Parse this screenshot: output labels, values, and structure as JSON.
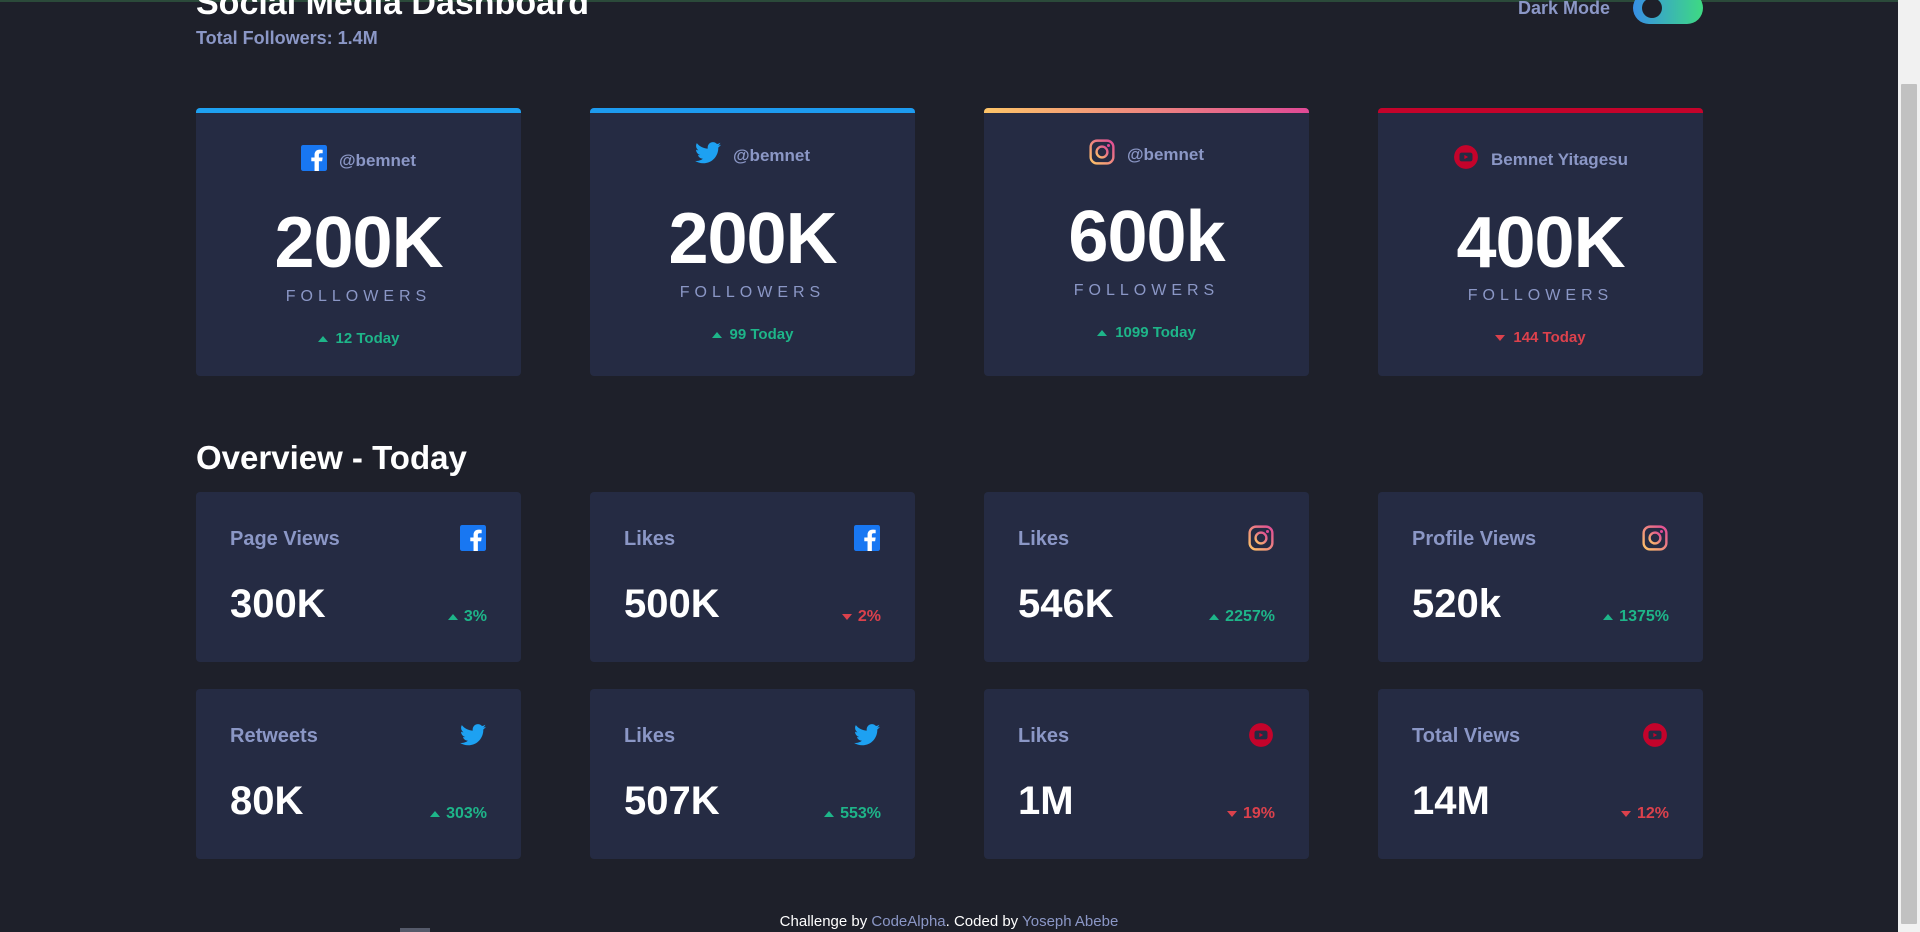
{
  "header": {
    "title": "Social Media Dashboard",
    "total_followers": "Total Followers: 1.4M",
    "mode_label": "Dark Mode"
  },
  "colors": {
    "background": "#1e202a",
    "card": "#252b43",
    "text_muted": "#8b97c6",
    "up": "#1eb589",
    "down": "#dc414c",
    "facebook": "#1877f2",
    "twitter": "#1da1f2",
    "youtube": "#c4032b"
  },
  "cards": [
    {
      "platform": "facebook",
      "handle": "@bemnet",
      "count": "200K",
      "label": "FOLLOWERS",
      "today": "12 Today",
      "trend": "up"
    },
    {
      "platform": "twitter",
      "handle": "@bemnet",
      "count": "200K",
      "label": "FOLLOWERS",
      "today": "99 Today",
      "trend": "up"
    },
    {
      "platform": "instagram",
      "handle": "@bemnet",
      "count": "600k",
      "label": "FOLLOWERS",
      "today": "1099 Today",
      "trend": "up"
    },
    {
      "platform": "youtube",
      "handle": "Bemnet Yitagesu",
      "count": "400K",
      "label": "FOLLOWERS",
      "today": "144 Today",
      "trend": "down"
    }
  ],
  "overview": {
    "title": "Overview - Today",
    "items": [
      {
        "name": "Page Views",
        "icon": "facebook-icon",
        "value": "300K",
        "delta": "3%",
        "trend": "up"
      },
      {
        "name": "Likes",
        "icon": "facebook-icon",
        "value": "500K",
        "delta": "2%",
        "trend": "down"
      },
      {
        "name": "Likes",
        "icon": "instagram-icon",
        "value": "546K",
        "delta": "2257%",
        "trend": "up"
      },
      {
        "name": "Profile Views",
        "icon": "instagram-icon",
        "value": "520k",
        "delta": "1375%",
        "trend": "up"
      },
      {
        "name": "Retweets",
        "icon": "twitter-icon",
        "value": "80K",
        "delta": "303%",
        "trend": "up"
      },
      {
        "name": "Likes",
        "icon": "twitter-icon",
        "value": "507K",
        "delta": "553%",
        "trend": "up"
      },
      {
        "name": "Likes",
        "icon": "youtube-icon",
        "value": "1M",
        "delta": "19%",
        "trend": "down"
      },
      {
        "name": "Total Views",
        "icon": "youtube-icon",
        "value": "14M",
        "delta": "12%",
        "trend": "down"
      }
    ]
  },
  "footer": {
    "prefix": "Challenge by ",
    "link1": "CodeAlpha",
    "middle": ". Coded by ",
    "link2": "Yoseph Abebe"
  }
}
